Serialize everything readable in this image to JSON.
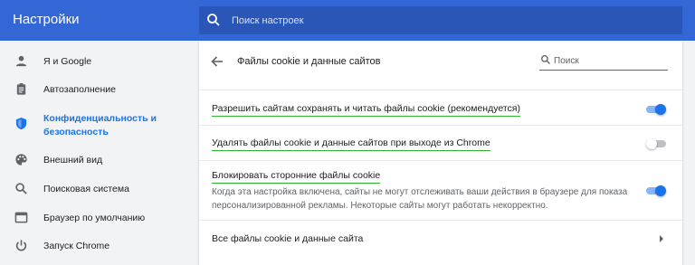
{
  "header": {
    "title": "Настройки",
    "search_placeholder": "Поиск настроек"
  },
  "sidebar": {
    "items": [
      {
        "label": "Я и Google",
        "icon": "person-icon"
      },
      {
        "label": "Автозаполнение",
        "icon": "clipboard-icon"
      },
      {
        "label": "Конфиденциальность и безопасность",
        "icon": "shield-icon",
        "active": true
      },
      {
        "label": "Внешний вид",
        "icon": "palette-icon"
      },
      {
        "label": "Поисковая система",
        "icon": "search-icon"
      },
      {
        "label": "Браузер по умолчанию",
        "icon": "browser-icon"
      },
      {
        "label": "Запуск Chrome",
        "icon": "power-icon"
      }
    ]
  },
  "card": {
    "title": "Файлы cookie и данные сайтов",
    "search_placeholder": "Поиск",
    "settings": [
      {
        "label": "Разрешить сайтам сохранять и читать файлы cookie (рекомендуется)",
        "enabled": true
      },
      {
        "label": "Удалять файлы cookie и данные сайтов при выходе из Chrome",
        "enabled": false
      },
      {
        "label": "Блокировать сторонние файлы cookie",
        "description": "Когда эта настройка включена, сайты не могут отслеживать ваши действия в браузере для показа персонализированной рекламы. Некоторые сайты могут работать некорректно.",
        "enabled": true
      }
    ],
    "all_cookies_link": "Все файлы cookie и данные сайта"
  },
  "colors": {
    "header": "#3367d6",
    "accent": "#1a73e8",
    "underline": "#2fb62f"
  }
}
